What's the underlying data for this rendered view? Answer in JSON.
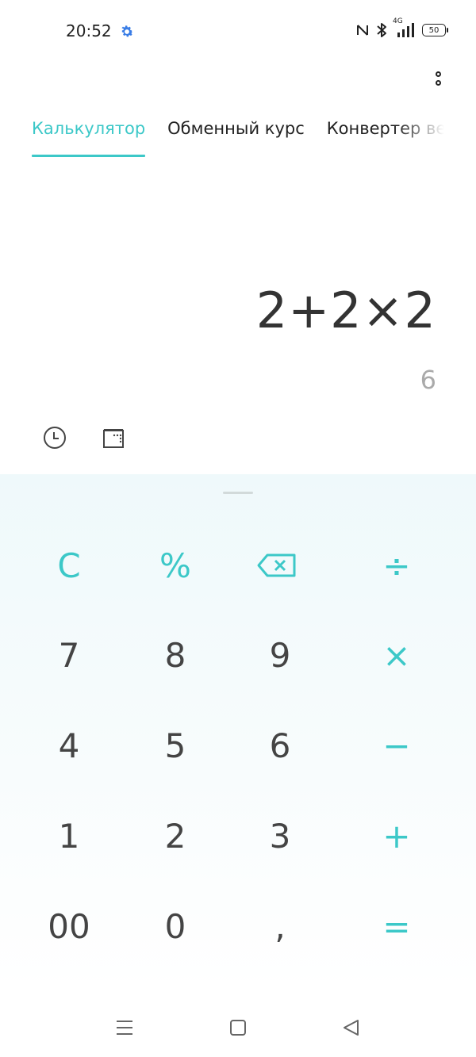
{
  "status_bar": {
    "time": "20:52",
    "network": "4G",
    "battery": "50"
  },
  "tabs": [
    {
      "label": "Калькулятор",
      "active": true
    },
    {
      "label": "Обменный курс",
      "active": false
    },
    {
      "label": "Конвертер величин",
      "active": false
    }
  ],
  "display": {
    "expression": "2+2×2",
    "result": "6"
  },
  "keys": {
    "clear": "C",
    "percent": "%",
    "divide": "÷",
    "seven": "7",
    "eight": "8",
    "nine": "9",
    "multiply": "×",
    "four": "4",
    "five": "5",
    "six": "6",
    "minus": "−",
    "one": "1",
    "two": "2",
    "three": "3",
    "plus": "+",
    "double_zero": "00",
    "zero": "0",
    "comma": ",",
    "equals": "="
  },
  "colors": {
    "accent": "#3cc8c8",
    "text": "#333333",
    "result": "#aaaaaa",
    "keypad_bg": "#eff9fb"
  },
  "icons": {
    "settings": "gear-icon",
    "nfc": "nfc-icon",
    "bluetooth": "bluetooth-icon",
    "signal": "signal-icon",
    "menu": "more-vertical-icon",
    "history": "clock-icon",
    "scientific": "scientific-mode-icon",
    "backspace": "backspace-icon",
    "nav_menu": "menu-icon",
    "nav_home": "home-icon",
    "nav_back": "back-icon"
  }
}
